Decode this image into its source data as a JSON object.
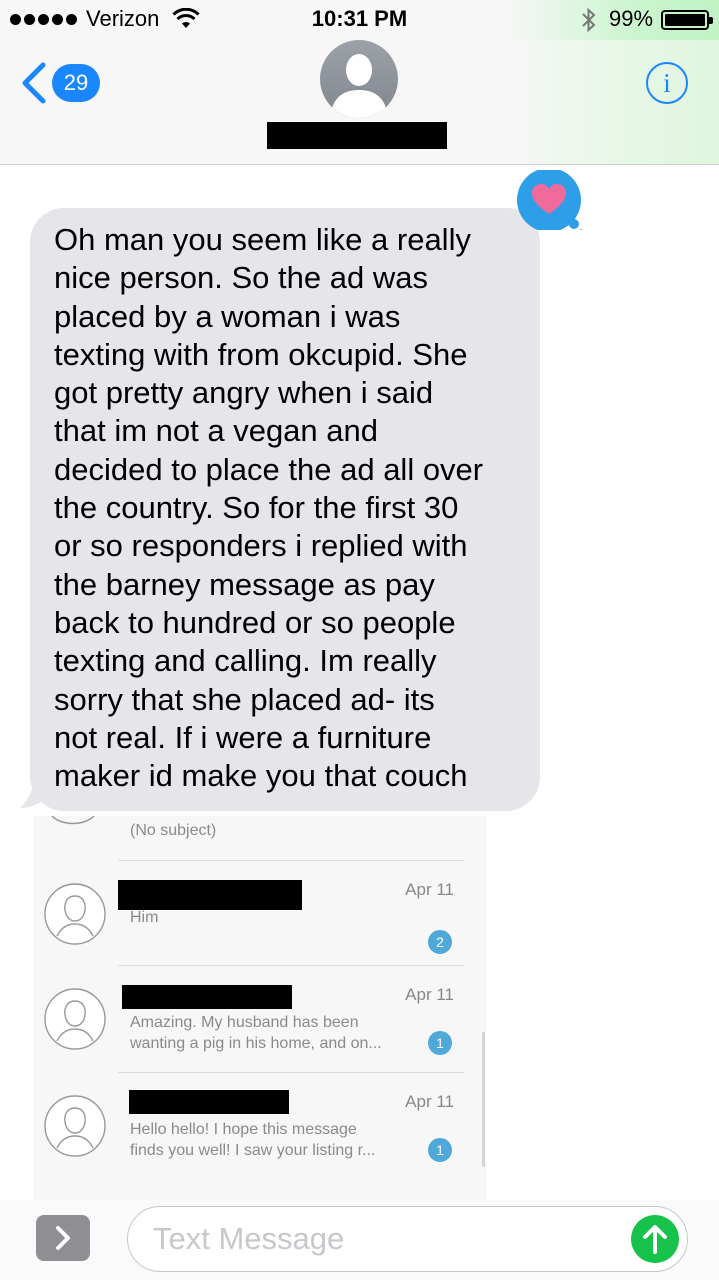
{
  "status_bar": {
    "carrier": "Verizon",
    "time": "10:31 PM",
    "battery": "99%",
    "signal_bars_filled": 5,
    "icons": [
      "signal-dots-icon",
      "wifi-icon",
      "bluetooth-icon",
      "battery-icon"
    ]
  },
  "header": {
    "back_count": "29",
    "info_label": "i",
    "icons": [
      "back-chevron-icon",
      "avatar-silhouette-icon",
      "info-icon"
    ]
  },
  "messages": [
    {
      "sender": "received",
      "text": "Oh man you seem like a really\nnice person.  So the ad was\nplaced by a woman i was\ntexting with from okcupid.  She\ngot pretty angry when i said\nthat im not a vegan and\ndecided to place the ad all over\nthe country.  So for the first 30\nor so responders i replied with\nthe barney message as pay\nback to hundred or so people\ntexting and calling.  Im really\nsorry that she placed ad- its\nnot real.  If i were a furniture\nmaker id make you that couch",
      "tapback": "heart-icon"
    }
  ],
  "attachment": {
    "partial_row_text": "(No subject)",
    "rows": [
      {
        "date": "Apr 11",
        "preview": "Him",
        "count": "2"
      },
      {
        "date": "Apr 11",
        "preview": "Amazing. My husband has been\nwanting a pig in his home, and on...",
        "count": "1"
      },
      {
        "date": "Apr 11",
        "preview": "Hello hello! I hope this message\nfinds you well! I saw your listing r...",
        "count": "1"
      }
    ]
  },
  "input": {
    "placeholder": "Text Message",
    "icons": [
      "chevron-right-icon",
      "send-arrow-icon"
    ]
  },
  "colors": {
    "ios_blue": "#1a87ff",
    "bubble_gray": "#e5e5ea",
    "send_green": "#16c24a",
    "tapback_blue": "#2f9ee8",
    "heart_pink": "#f06a9c",
    "badge_blue": "#4fa9d8"
  }
}
